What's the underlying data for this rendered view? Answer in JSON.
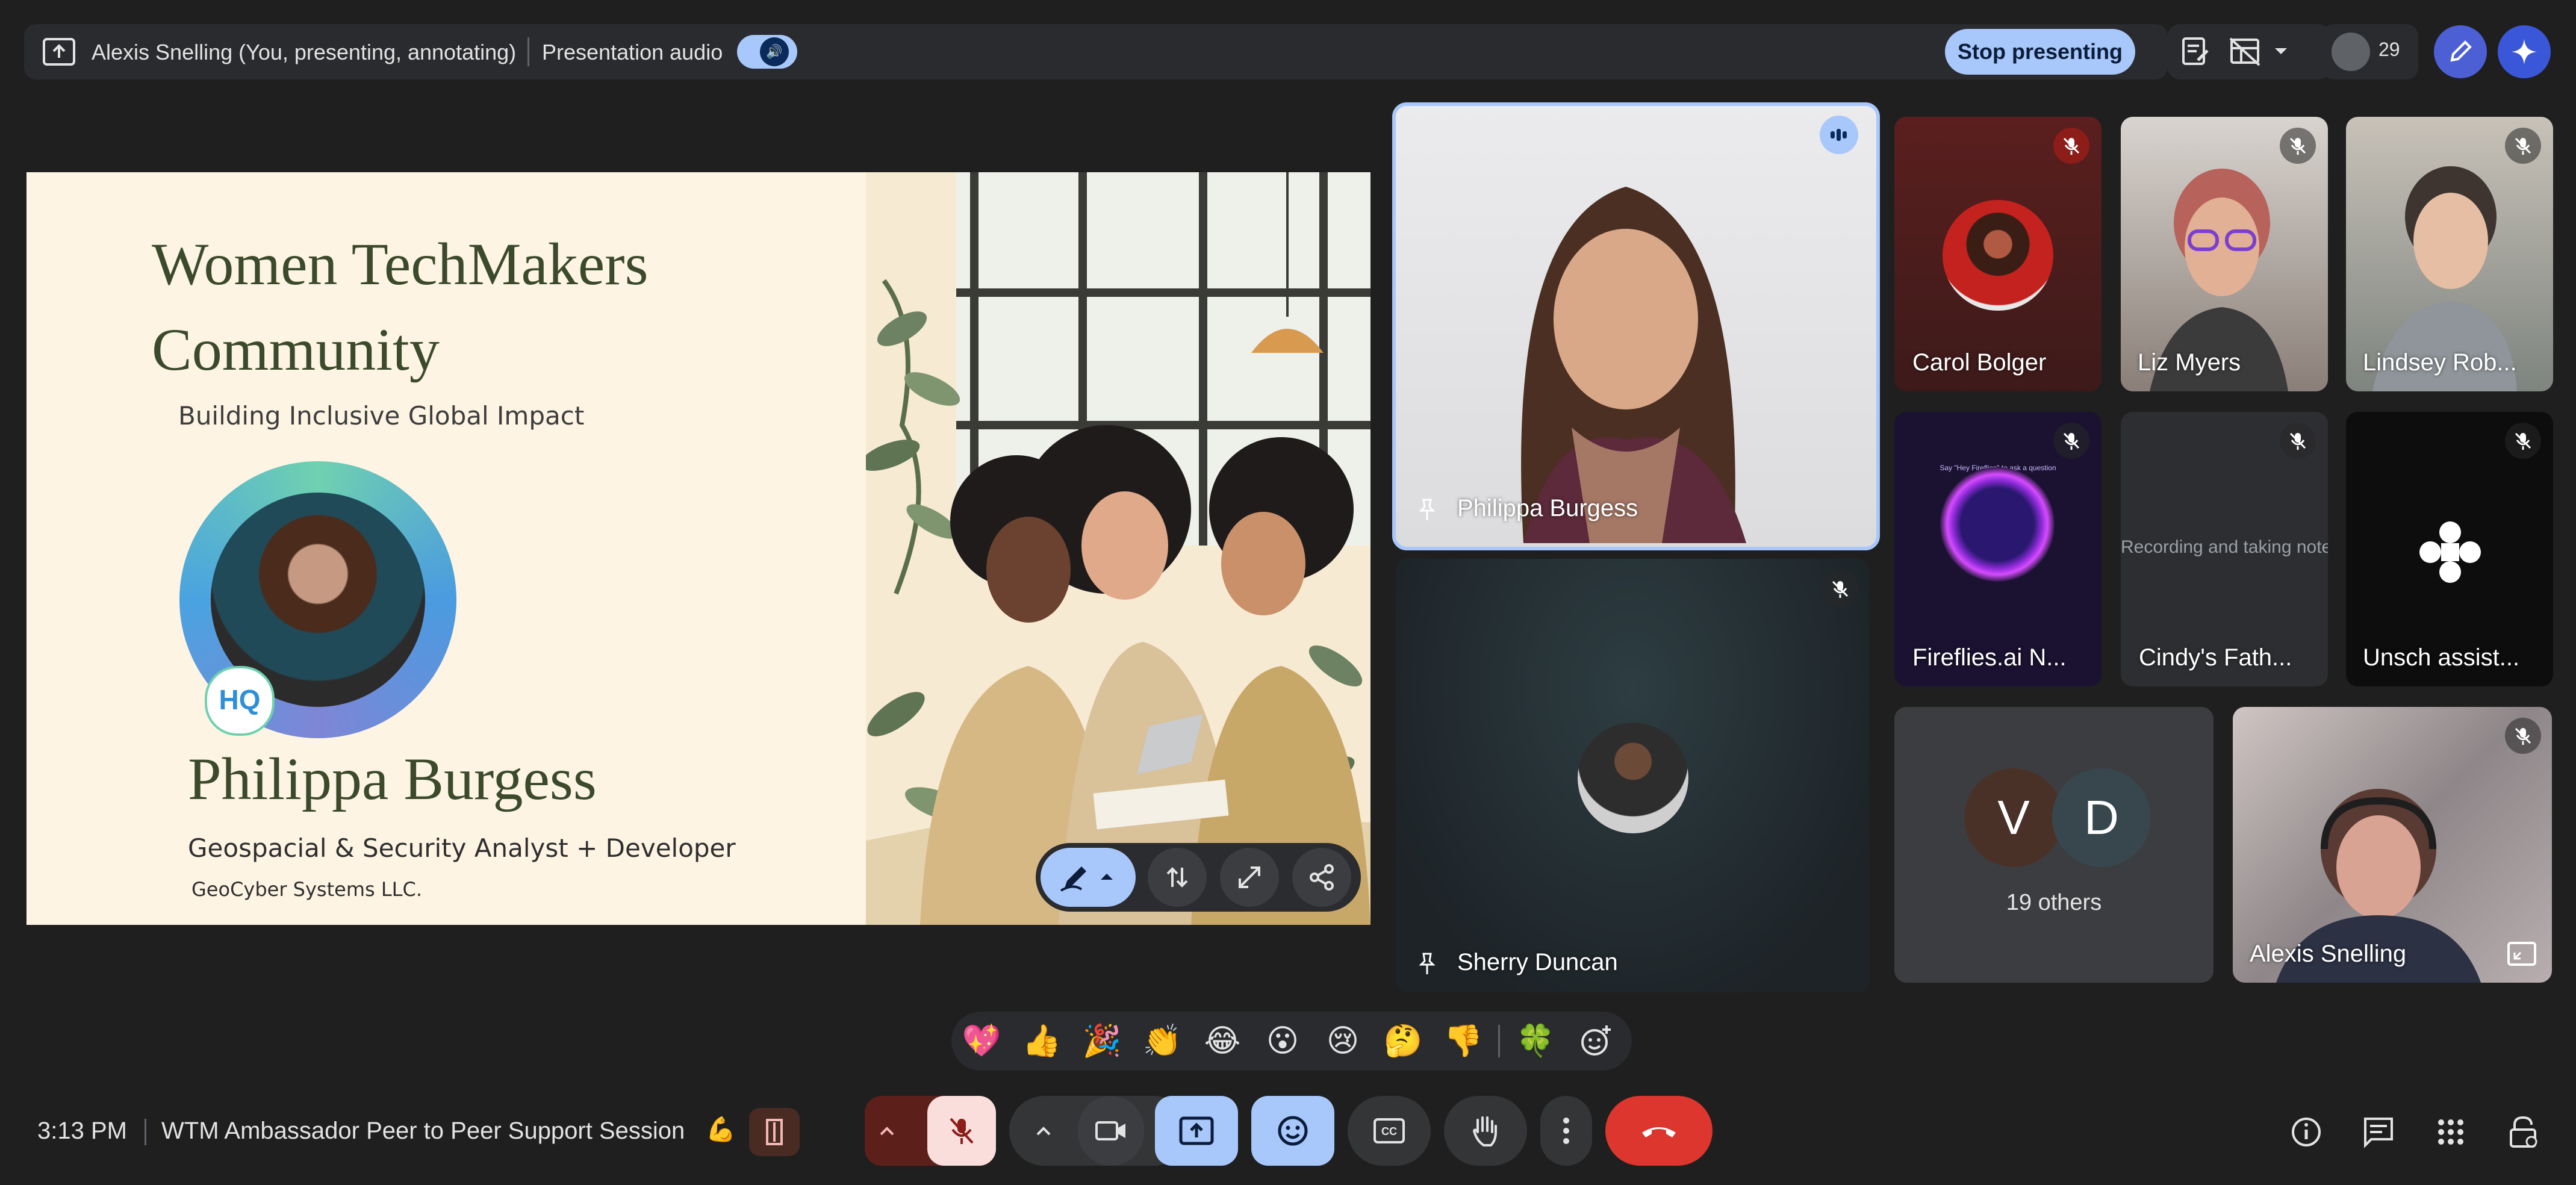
{
  "top_bar": {
    "presenting_text": "Alexis Snelling (You, presenting, annotating)",
    "audio_label": "Presentation audio",
    "audio_enabled": true,
    "stop_presenting_label": "Stop presenting",
    "participant_count": "29"
  },
  "slide": {
    "title_line1": "Women TechMakers",
    "title_line2": "Community",
    "subtitle": "Building Inclusive Global Impact",
    "badge_text": "HQ",
    "name": "Philippa Burgess",
    "role": "Geospacial & Security Analyst + Developer",
    "company": "GeoCyber Systems LLC."
  },
  "tiles": {
    "philippa": "Philippa Burgess",
    "sherry": "Sherry Duncan",
    "carol": "Carol Bolger",
    "liz": "Liz Myers",
    "lindsey": "Lindsey Rob...",
    "fireflies": "Fireflies.ai N...",
    "fireflies_hint": "Say \"Hey Fireflies\" to ask a question",
    "cindy": "Cindy's Fath...",
    "cindy_status": "Recording and taking notes",
    "unsch": "Unsch assist...",
    "others_v": "V",
    "others_d": "D",
    "others_count": "19 others",
    "alexis": "Alexis Snelling"
  },
  "reactions": [
    "💖",
    "👍",
    "🎉",
    "👏",
    "😂",
    "😮",
    "😢",
    "🤔",
    "👎",
    "🍀"
  ],
  "bottom_bar": {
    "time": "3:13 PM",
    "meeting_title": "WTM Ambassador Peer to Peer Support Session",
    "meeting_emoji": "💪"
  },
  "colors": {
    "accent": "#a8c7fa",
    "danger": "#dc362e",
    "background": "#1f1f1f",
    "slide_bg": "#fdf4e3",
    "slide_title": "#3b4a2b"
  },
  "icons": {
    "present": "present-to-all-icon",
    "mute": "mic-off-icon",
    "pin": "pin-icon",
    "hangup": "call-end-icon"
  }
}
